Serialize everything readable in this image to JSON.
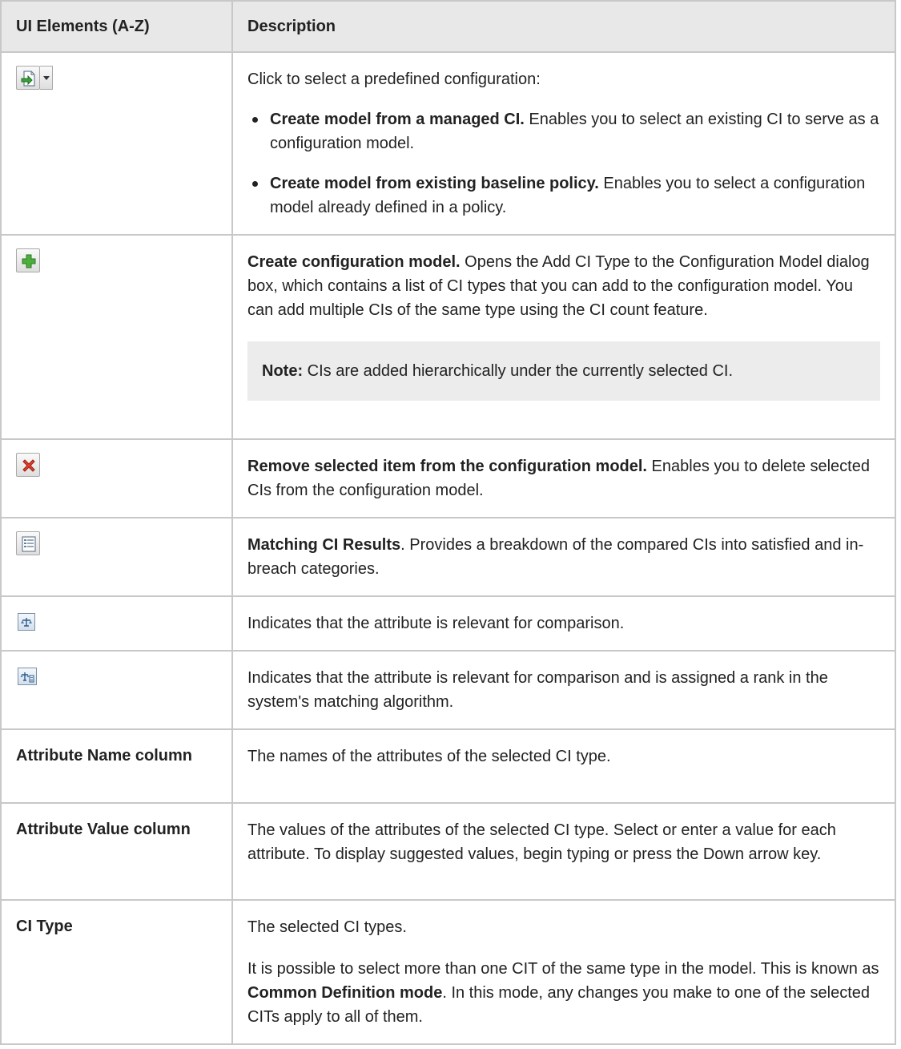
{
  "table": {
    "col1_header": "UI Elements (A-Z)",
    "col2_header": "Description"
  },
  "rows": [
    {
      "icon": "import-config-dropdown-icon",
      "intro": "Click to select a predefined configuration:",
      "bullets": [
        {
          "bold": "Create model from a managed CI.",
          "text": " Enables you to select an existing CI to serve as a configuration model."
        },
        {
          "bold": "Create model from existing baseline policy.",
          "text": " Enables you to select a configuration model already defined in a policy."
        }
      ]
    },
    {
      "icon": "add-green-plus-icon",
      "bold": "Create configuration model.",
      "text": " Opens the Add CI Type to the Configuration Model dialog box, which contains a list of CI types that you can add to the configuration model. You can add multiple CIs of the same type using the CI count feature.",
      "note_label": "Note:",
      "note_text": " CIs are added hierarchically under the currently selected CI."
    },
    {
      "icon": "remove-red-x-icon",
      "bold": "Remove selected item from the configuration model.",
      "text": " Enables you to delete selected CIs from the configuration model."
    },
    {
      "icon": "matching-results-list-icon",
      "bold": "Matching CI Results",
      "text": ". Provides a breakdown of the compared CIs into satisfied and in-breach categories."
    },
    {
      "icon": "compare-relevant-icon",
      "text": "Indicates that the attribute is relevant for comparison."
    },
    {
      "icon": "compare-rank-icon",
      "text": "Indicates that the attribute is relevant for comparison and is assigned a rank in the system's matching algorithm."
    },
    {
      "label": "Attribute Name column",
      "text": "The names of the attributes of the selected CI type."
    },
    {
      "label": "Attribute Value column",
      "text": "The values of the attributes of the selected CI type. Select or enter a value for each attribute. To display suggested values, begin typing or press the Down arrow key."
    },
    {
      "label": "CI Type",
      "text": "The selected CI types.",
      "p2_a": "It is possible to select more than one CIT of the same type in the model. This is known as ",
      "p2_bold": "Common Definition mode",
      "p2_b": ". In this mode, any changes you make to one of the selected CITs apply to all of them."
    }
  ]
}
